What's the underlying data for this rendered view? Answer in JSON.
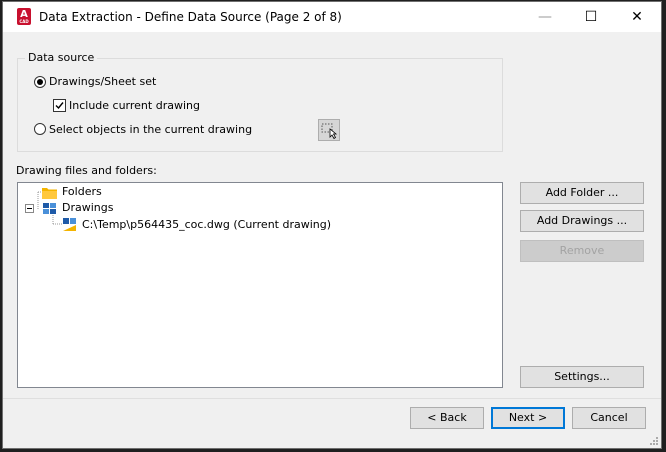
{
  "window": {
    "title": "Data Extraction - Define Data Source (Page 2 of 8)",
    "app_icon_letter": "A",
    "app_icon_sub": "CAD",
    "controls": {
      "minimize": "—",
      "maximize": "☐",
      "close": "✕"
    }
  },
  "data_source": {
    "group_label": "Data source",
    "option_drawings": "Drawings/Sheet set",
    "include_current": "Include current drawing",
    "option_select_objects": "Select objects in the current drawing",
    "selected": "drawings_sheet_set",
    "include_current_checked": true
  },
  "drawing_files": {
    "label": "Drawing files and folders:",
    "tree": {
      "folders_label": "Folders",
      "drawings_label": "Drawings",
      "drawing_item": "C:\\Temp\\p564435_coc.dwg (Current drawing)"
    }
  },
  "side_buttons": {
    "add_folder": "Add Folder ...",
    "add_drawings": "Add Drawings ...",
    "remove": "Remove",
    "settings": "Settings..."
  },
  "footer_buttons": {
    "back": "< Back",
    "next": "Next >",
    "cancel": "Cancel"
  },
  "colors": {
    "folder": "#f4b400",
    "drawing_icon_blue": "#1e5aa8",
    "default_button_border": "#0078d7",
    "app_icon": "#c8102e"
  }
}
